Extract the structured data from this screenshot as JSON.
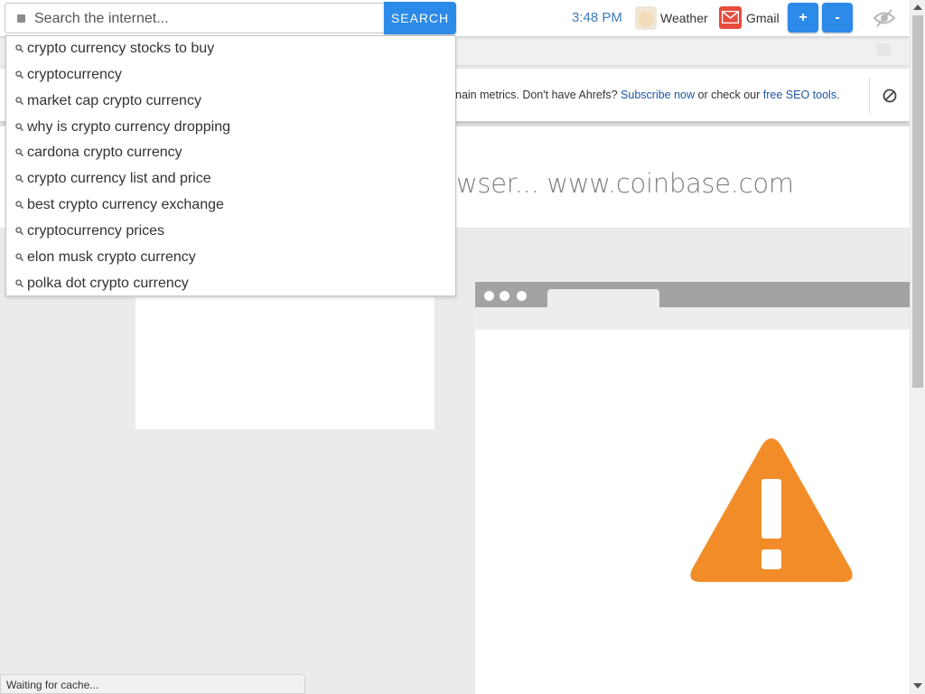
{
  "toolbar": {
    "search_placeholder": "Search the internet...",
    "search_button": "SEARCH",
    "clock": "3:48 PM",
    "weather_label": "Weather",
    "gmail_label": "Gmail",
    "zoom_in": "+",
    "zoom_out": "-"
  },
  "banner": {
    "text_before": "nain metrics. Don't have Ahrefs? ",
    "subscribe_link": "Subscribe now",
    "text_middle": " or check our ",
    "seo_link": "free SEO tools",
    "text_end": "."
  },
  "headline": "wser... www.coinbase.com",
  "suggestions": [
    "crypto currency stocks to buy",
    "cryptocurrency",
    "market cap crypto currency",
    "why is crypto currency dropping",
    "cardona crypto currency",
    "crypto currency list and price",
    "best crypto currency exchange",
    "cryptocurrency prices",
    "elon musk crypto currency",
    "polka dot crypto currency"
  ],
  "status": "Waiting for cache...",
  "icons": {
    "search": "search-icon",
    "weather": "weather-icon",
    "gmail": "gmail-icon",
    "hide": "eye-slash-icon",
    "close": "block-icon",
    "warning": "warning-icon"
  },
  "colors": {
    "accent": "#2c8ae8",
    "link": "#1c56a8",
    "warning": "#f28c28",
    "gmail": "#e74c3c"
  }
}
